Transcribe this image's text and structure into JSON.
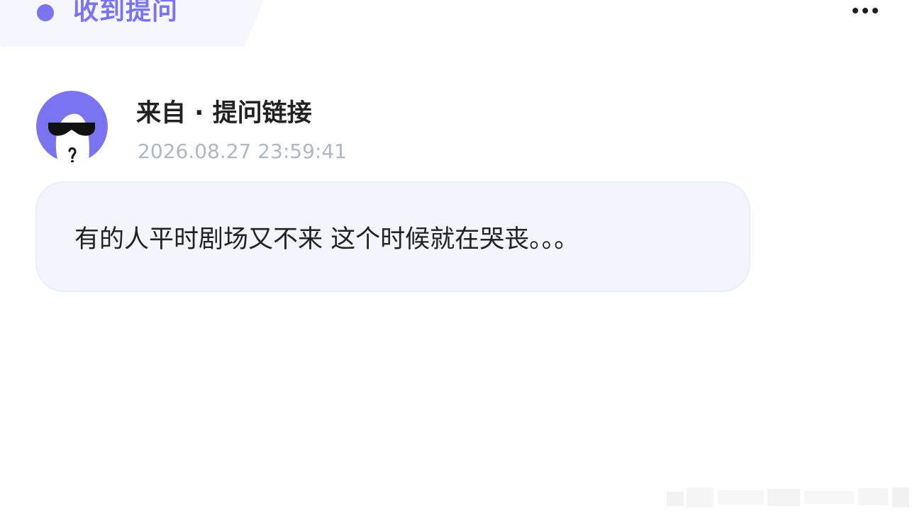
{
  "header": {
    "tab_title": "收到提问",
    "accent_color": "#7a74f1",
    "more_icon": "more-horizontal-icon"
  },
  "question": {
    "source_label": "来自 · 提问链接",
    "timestamp": "2026.08.27 23:59:41",
    "avatar_icon": "anonymous-sunglasses-avatar",
    "body": "有的人平时剧场又不来 这个时候就在哭丧。。。"
  }
}
